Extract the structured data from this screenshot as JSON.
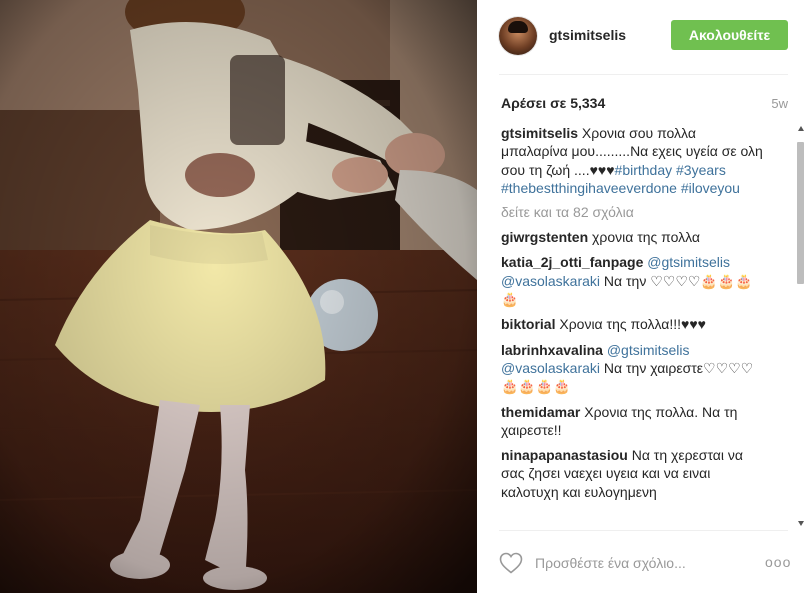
{
  "post": {
    "username": "gtsimitselis",
    "follow_label": "Ακολουθείτε",
    "likes": "Αρέσει σε 5,334",
    "age": "5w",
    "view_all": "δείτε και τα 82 σχόλια",
    "comment_placeholder": "Προσθέστε ένα σχόλιο...",
    "options_glyph": "ooo"
  },
  "caption": {
    "user": "gtsimitselis",
    "text": "Χρονια σου πολλα μπαλαρίνα μου.........Να εχεις υγεία σε ολη σου τη ζωή ....♥♥♥",
    "tags": [
      "#birthday",
      "#3years",
      "#thebestthingihaveeverdone",
      "#iloveyou"
    ]
  },
  "comments": [
    {
      "user": "giwrgstenten",
      "text": "χρονια της πολλα"
    },
    {
      "user": "katia_2j_otti_fanpage",
      "mentions": [
        "@gtsimitselis",
        "@vasolaskaraki"
      ],
      "text": "Να την ♡♡♡♡🎂🎂🎂🎂"
    },
    {
      "user": "biktorial",
      "text": "Χρονια της πολλα!!!♥♥♥"
    },
    {
      "user": "labrinhxavalina",
      "mentions": [
        "@gtsimitselis",
        "@vasolaskaraki"
      ],
      "text": "Να την χαιρεστε♡♡♡♡🎂🎂🎂🎂"
    },
    {
      "user": "themidamar",
      "text": "Χρονια της πολλα. Να τη χαιρεστε!!"
    },
    {
      "user": "ninapapanastasiou",
      "text": "Να τη χερεσται να σας ζησει ναεχει υγεια και να ειναι καλοτυχη και ευλογημενη"
    }
  ],
  "colors": {
    "follow_button": "#70c050",
    "hashtag": "#3f729b",
    "muted": "#999999"
  },
  "icons": {
    "like": "heart-outline-icon",
    "options": "more-options-icon"
  }
}
